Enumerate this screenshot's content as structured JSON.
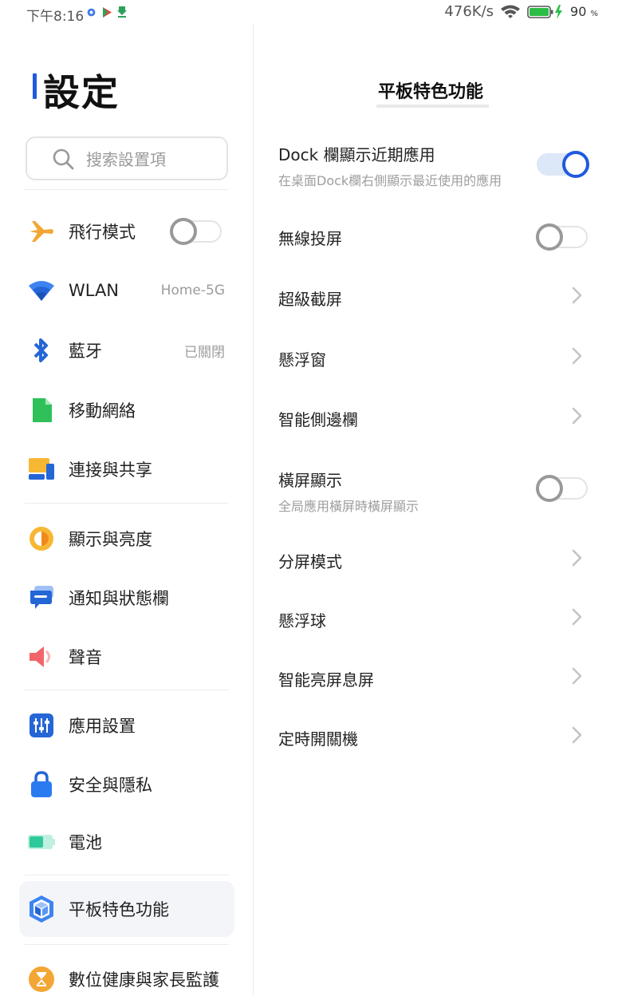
{
  "status_bar": {
    "time": "下午8:16",
    "net_speed": "476K/s",
    "battery_percent": "90",
    "battery_unit": "%",
    "icons": [
      "settings-gear-icon",
      "play-store-icon",
      "download-icon",
      "wifi-icon",
      "battery-charging-icon"
    ]
  },
  "sidebar": {
    "title": "設定",
    "search_placeholder": "搜索設置項",
    "items": [
      {
        "label": "飛行模式",
        "icon": "airplane-icon",
        "toggle": false
      },
      {
        "label": "WLAN",
        "icon": "wifi-icon",
        "value": "Home-5G"
      },
      {
        "label": "藍牙",
        "icon": "bluetooth-icon",
        "value": "已關閉"
      },
      {
        "label": "移動網絡",
        "icon": "sim-card-icon"
      },
      {
        "label": "連接與共享",
        "icon": "connection-share-icon"
      },
      {
        "label": "顯示與亮度",
        "icon": "brightness-icon"
      },
      {
        "label": "通知與狀態欄",
        "icon": "notification-icon"
      },
      {
        "label": "聲音",
        "icon": "speaker-icon"
      },
      {
        "label": "應用設置",
        "icon": "app-settings-icon"
      },
      {
        "label": "安全與隱私",
        "icon": "lock-icon"
      },
      {
        "label": "電池",
        "icon": "battery-icon"
      },
      {
        "label": "平板特色功能",
        "icon": "tablet-cube-icon",
        "selected": true
      },
      {
        "label": "數位健康與家長監護",
        "icon": "hourglass-icon"
      }
    ]
  },
  "detail": {
    "title": "平板特色功能",
    "items": [
      {
        "label": "Dock 欄顯示近期應用",
        "subtitle": "在桌面Dock欄右側顯示最近使用的應用",
        "toggle": true
      },
      {
        "label": "無線投屏",
        "toggle": false
      },
      {
        "label": "超級截屏",
        "chevron": true
      },
      {
        "label": "懸浮窗",
        "chevron": true
      },
      {
        "label": "智能側邊欄",
        "chevron": true
      },
      {
        "label": "橫屏顯示",
        "subtitle": "全局應用橫屏時橫屏顯示",
        "toggle": false
      },
      {
        "label": "分屏模式",
        "chevron": true
      },
      {
        "label": "懸浮球",
        "chevron": true
      },
      {
        "label": "智能亮屏息屏",
        "chevron": true
      },
      {
        "label": "定時開關機",
        "chevron": true
      }
    ]
  },
  "colors": {
    "accent": "#1f5ae0",
    "toggle_off": "#999999",
    "toggle_on_track": "#dce7f8",
    "selected_bg": "#f3f5f8"
  }
}
